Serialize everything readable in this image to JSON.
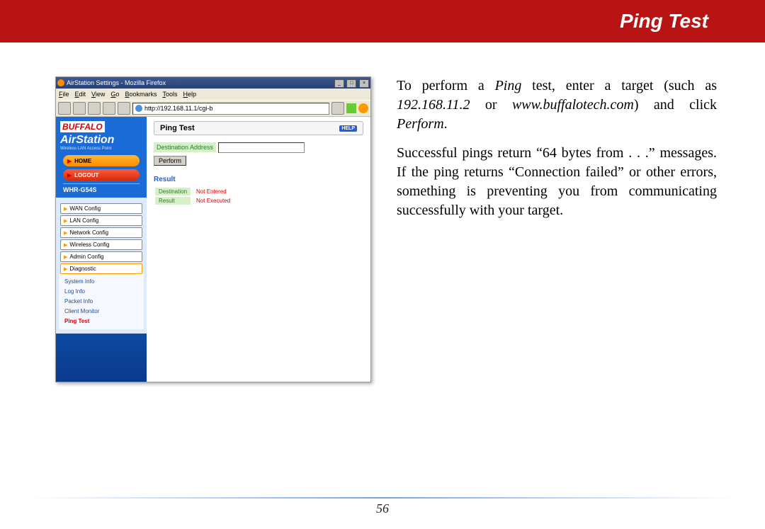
{
  "header": {
    "title": "Ping Test"
  },
  "screenshot": {
    "window_title": "AirStation Settings - Mozilla Firefox",
    "menubar": [
      "File",
      "Edit",
      "View",
      "Go",
      "Bookmarks",
      "Tools",
      "Help"
    ],
    "url": "http://192.168.11.1/cgi-b",
    "brand_top": "BUFFALO",
    "brand_main": "AirStation",
    "brand_sub": "Wireless LAN Access Point",
    "btn_home": "HOME",
    "btn_logout": "LOGOUT",
    "model": "WHR-G54S",
    "nav_tabs": [
      "WAN Config",
      "LAN Config",
      "Network Config",
      "Wireless Config",
      "Admin Config",
      "Diagnostic"
    ],
    "sub_links": [
      "System Info",
      "Log Info",
      "Packet Info",
      "Client Monitor",
      "Ping Test"
    ],
    "pane_title": "Ping Test",
    "help_label": "HELP",
    "dest_label": "Destination Address",
    "dest_value": "",
    "perform_label": "Perform",
    "result_heading": "Result",
    "result_rows": [
      {
        "k": "Destination",
        "v": "Not Entered"
      },
      {
        "k": "Result",
        "v": "Not Executed"
      }
    ]
  },
  "body": {
    "p1_a": "To perform a ",
    "p1_b": "Ping",
    "p1_c": " test, enter a target (such as ",
    "p1_d": "192.168.11.2",
    "p1_e": " or ",
    "p1_f": "www.buffalotech.com",
    "p1_g": ") and click ",
    "p1_h": "Perform",
    "p1_i": ".",
    "p2": "Successful pings return “64 bytes from . . .” messages.  If the ping returns “Connection failed” or other errors, something is preventing you from communicating successfully with your target."
  },
  "footer": {
    "page": "56"
  }
}
